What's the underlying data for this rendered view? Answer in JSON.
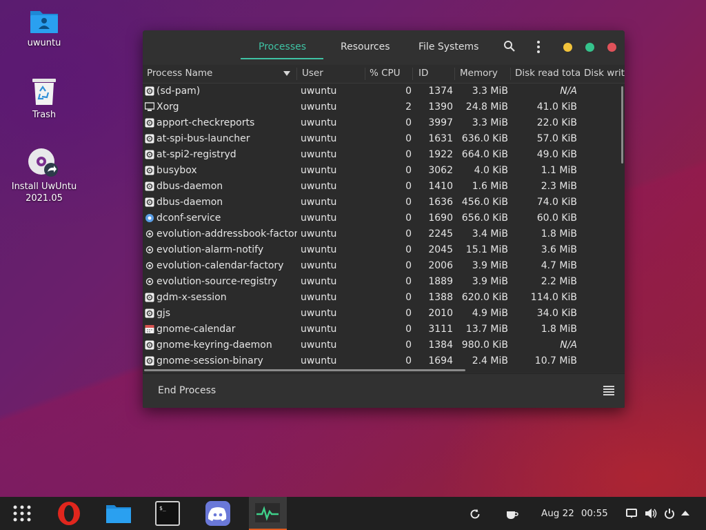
{
  "desktop": {
    "icons": [
      {
        "label": "uwuntu"
      },
      {
        "label": "Trash"
      },
      {
        "label": "Install UwUntu\n2021.05",
        "line1": "Install UwUntu",
        "line2": "2021.05"
      }
    ]
  },
  "window": {
    "tabs": [
      "Processes",
      "Resources",
      "File Systems"
    ],
    "active_tab": "Processes",
    "accent_color": "#3fc3a4",
    "columns": [
      "Process Name",
      "User",
      "% CPU",
      "ID",
      "Memory",
      "Disk read tota",
      "Disk writ"
    ],
    "sort_column": "Process Name",
    "rows": [
      {
        "icon": "gear-icon",
        "name": "(sd-pam)",
        "user": "uwuntu",
        "cpu": "0",
        "id": "1374",
        "mem": "3.3 MiB",
        "disk": "N/A"
      },
      {
        "icon": "monitor-icon",
        "name": "Xorg",
        "user": "uwuntu",
        "cpu": "2",
        "id": "1390",
        "mem": "24.8 MiB",
        "disk": "41.0 KiB"
      },
      {
        "icon": "gear-icon",
        "name": "apport-checkreports",
        "user": "uwuntu",
        "cpu": "0",
        "id": "3997",
        "mem": "3.3 MiB",
        "disk": "22.0 KiB"
      },
      {
        "icon": "gear-icon",
        "name": "at-spi-bus-launcher",
        "user": "uwuntu",
        "cpu": "0",
        "id": "1631",
        "mem": "636.0 KiB",
        "disk": "57.0 KiB"
      },
      {
        "icon": "gear-icon",
        "name": "at-spi2-registryd",
        "user": "uwuntu",
        "cpu": "0",
        "id": "1922",
        "mem": "664.0 KiB",
        "disk": "49.0 KiB"
      },
      {
        "icon": "gear-icon",
        "name": "busybox",
        "user": "uwuntu",
        "cpu": "0",
        "id": "3062",
        "mem": "4.0 KiB",
        "disk": "1.1 MiB"
      },
      {
        "icon": "gear-icon",
        "name": "dbus-daemon",
        "user": "uwuntu",
        "cpu": "0",
        "id": "1410",
        "mem": "1.6 MiB",
        "disk": "2.3 MiB"
      },
      {
        "icon": "gear-icon",
        "name": "dbus-daemon",
        "user": "uwuntu",
        "cpu": "0",
        "id": "1636",
        "mem": "456.0 KiB",
        "disk": "74.0 KiB"
      },
      {
        "icon": "cog-blue-icon",
        "name": "dconf-service",
        "user": "uwuntu",
        "cpu": "0",
        "id": "1690",
        "mem": "656.0 KiB",
        "disk": "60.0 KiB"
      },
      {
        "icon": "at-sign-icon",
        "name": "evolution-addressbook-factory",
        "user": "uwuntu",
        "cpu": "0",
        "id": "2245",
        "mem": "3.4 MiB",
        "disk": "1.8 MiB"
      },
      {
        "icon": "at-sign-icon",
        "name": "evolution-alarm-notify",
        "user": "uwuntu",
        "cpu": "0",
        "id": "2045",
        "mem": "15.1 MiB",
        "disk": "3.6 MiB"
      },
      {
        "icon": "at-sign-icon",
        "name": "evolution-calendar-factory",
        "user": "uwuntu",
        "cpu": "0",
        "id": "2006",
        "mem": "3.9 MiB",
        "disk": "4.7 MiB"
      },
      {
        "icon": "at-sign-icon",
        "name": "evolution-source-registry",
        "user": "uwuntu",
        "cpu": "0",
        "id": "1889",
        "mem": "3.9 MiB",
        "disk": "2.2 MiB"
      },
      {
        "icon": "gear-icon",
        "name": "gdm-x-session",
        "user": "uwuntu",
        "cpu": "0",
        "id": "1388",
        "mem": "620.0 KiB",
        "disk": "114.0 KiB"
      },
      {
        "icon": "gear-icon",
        "name": "gjs",
        "user": "uwuntu",
        "cpu": "0",
        "id": "2010",
        "mem": "4.9 MiB",
        "disk": "34.0 KiB"
      },
      {
        "icon": "calendar-icon",
        "name": "gnome-calendar",
        "user": "uwuntu",
        "cpu": "0",
        "id": "3111",
        "mem": "13.7 MiB",
        "disk": "1.8 MiB"
      },
      {
        "icon": "gear-icon",
        "name": "gnome-keyring-daemon",
        "user": "uwuntu",
        "cpu": "0",
        "id": "1384",
        "mem": "980.0 KiB",
        "disk": "N/A"
      },
      {
        "icon": "gear-icon",
        "name": "gnome-session-binary",
        "user": "uwuntu",
        "cpu": "0",
        "id": "1694",
        "mem": "2.4 MiB",
        "disk": "10.7 MiB"
      }
    ],
    "end_process_label": "End Process"
  },
  "taskbar": {
    "date": "Aug 22",
    "time": "00:55",
    "apps": [
      "app-grid-icon",
      "opera-icon",
      "files-icon",
      "terminal-icon",
      "discord-icon",
      "system-monitor-icon"
    ],
    "active_app": "system-monitor-icon",
    "active_color": "#e05a1f"
  }
}
